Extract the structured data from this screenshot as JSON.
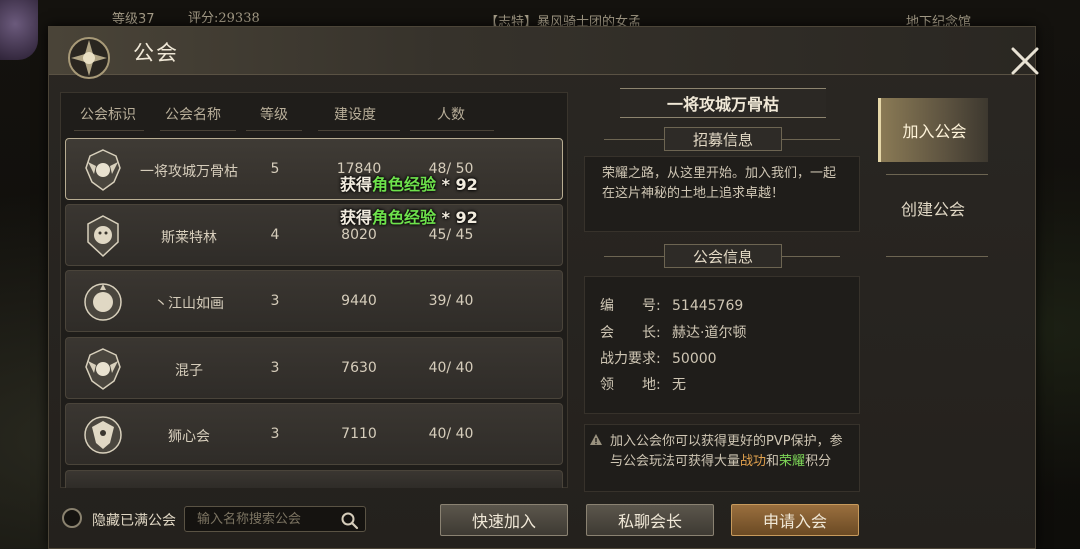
{
  "hud": {
    "level": "等级37",
    "score": "评分:29338",
    "chat": "【志特】暴风骑士团的女孟",
    "right": "地下纪念馆"
  },
  "panel": {
    "title": "公会"
  },
  "columns": [
    "公会标识",
    "公会名称",
    "等级",
    "建设度",
    "人数"
  ],
  "guilds": [
    {
      "name": "一将攻城万骨枯",
      "level": "5",
      "build": "17840",
      "members": "48/ 50",
      "emblem": "winged-lion-emblem"
    },
    {
      "name": "斯莱特林",
      "level": "4",
      "build": "8020",
      "members": "45/ 45",
      "emblem": "lion-head-emblem"
    },
    {
      "name": "丶江山如画",
      "level": "3",
      "build": "9440",
      "members": "39/ 40",
      "emblem": "lion-crest-emblem"
    },
    {
      "name": "混子",
      "level": "3",
      "build": "7630",
      "members": "40/ 40",
      "emblem": "winged-lion-emblem"
    },
    {
      "name": "狮心会",
      "level": "3",
      "build": "7110",
      "members": "40/ 40",
      "emblem": "dragon-emblem"
    }
  ],
  "float_messages": [
    {
      "prefix": "获得",
      "highlight": "角色经验",
      "suffix": " * 92"
    },
    {
      "prefix": "获得",
      "highlight": "角色经验",
      "suffix": " * 92"
    }
  ],
  "detail": {
    "guild_name": "一将攻城万骨枯",
    "recruit_title": "招募信息",
    "recruit_text": "荣耀之路，从这里开始。加入我们，一起在这片神秘的土地上追求卓越！",
    "info_title": "公会信息",
    "info": [
      {
        "label": "编　　号:",
        "value": "51445769"
      },
      {
        "label": "会　　长:",
        "value": "赫达·道尔顿"
      },
      {
        "label": "战力要求:",
        "value": "50000"
      },
      {
        "label": "领　　地:",
        "value": "无"
      }
    ],
    "notice": {
      "part1": "加入公会你可以获得更好的PVP保护，参与公会玩法可获得大量",
      "hl1": "战功",
      "part2": "和",
      "hl2": "荣耀",
      "part3": "积分"
    }
  },
  "tabs": [
    "加入公会",
    "创建公会"
  ],
  "bottom": {
    "hide_full_label": "隐藏已满公会",
    "search_placeholder": "输入名称搜索公会",
    "quick_join": "快速加入",
    "private_chat": "私聊会长",
    "apply_join": "申请入会"
  },
  "colors": {
    "accent_green": "#7ed858",
    "accent_gold": "#e2a24e",
    "primary_button": "#9a6f3e"
  }
}
